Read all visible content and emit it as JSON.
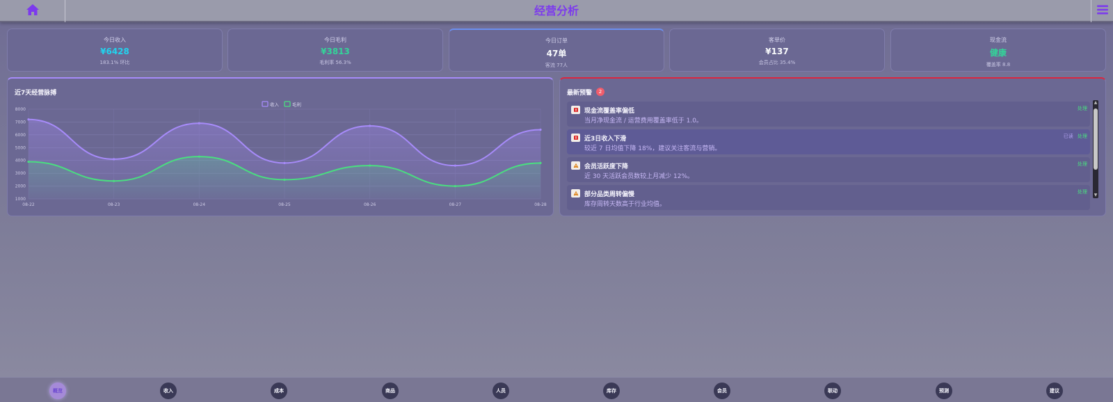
{
  "header": {
    "title": "经营分析",
    "home_icon": "home-icon",
    "menu_icon": "hamburger-menu-icon",
    "accent_color": "#7c3aed"
  },
  "kpis": [
    {
      "label": "今日收入",
      "value": "¥6428",
      "sub": "183.1% 环比",
      "color": "#22d3ee"
    },
    {
      "label": "今日毛利",
      "value": "¥3813",
      "sub": "毛利率 56.3%",
      "color": "#34d399"
    },
    {
      "label": "今日订单",
      "value": "47单",
      "sub": "客流 77人",
      "color": "#f8fafc"
    },
    {
      "label": "客单价",
      "value": "¥137",
      "sub": "会员占比 35.4%",
      "color": "#f8fafc"
    },
    {
      "label": "现金流",
      "value": "健康",
      "sub": "覆盖率 8.8",
      "color": "#34d399"
    }
  ],
  "trend_panel": {
    "title": "近7天经营脉搏"
  },
  "chart_data": {
    "type": "line",
    "title": "近7天经营脉搏",
    "categories": [
      "08-22",
      "08-23",
      "08-24",
      "08-25",
      "08-26",
      "08-27",
      "08-28"
    ],
    "series": [
      {
        "name": "收入",
        "color": "#a78bfa",
        "values": [
          7200,
          4100,
          6900,
          3800,
          6700,
          3600,
          6400
        ]
      },
      {
        "name": "毛利",
        "color": "#4ade80",
        "values": [
          3900,
          2400,
          4300,
          2500,
          3600,
          2000,
          3800
        ]
      }
    ],
    "ylim": [
      1000,
      8000
    ],
    "yticks": [
      "1000",
      "2000",
      "3000",
      "4000",
      "5000",
      "6000",
      "7000",
      "8000"
    ],
    "grid": true,
    "legend_position": "top-center",
    "smooth": true
  },
  "alerts_panel": {
    "title": "最新预警",
    "badge_count": "2",
    "items": [
      {
        "icon": "red-alert-icon",
        "icon_color": "#dc2626",
        "title": "现金流覆盖率偏低",
        "desc": "当月净现金流 / 运营费用覆盖率低于 1.0。",
        "read_label": "",
        "action_label": "处理"
      },
      {
        "icon": "red-alert-icon",
        "icon_color": "#dc2626",
        "title": "近3日收入下滑",
        "desc": "较近 7 日均值下降 18%，建议关注客流与营销。",
        "read_label": "已读",
        "action_label": "处理"
      },
      {
        "icon": "warning-icon",
        "icon_color": "#d97706",
        "title": "会员活跃度下降",
        "desc": "近 30 天活跃会员数较上月减少 12%。",
        "read_label": "",
        "action_label": "处理"
      },
      {
        "icon": "warning-icon",
        "icon_color": "#d97706",
        "title": "部分品类周转偏慢",
        "desc": "库存周转天数高于行业均值。",
        "read_label": "",
        "action_label": "处理"
      }
    ]
  },
  "bottom_nav": {
    "items": [
      "概览",
      "收入",
      "成本",
      "商品",
      "人员",
      "库存",
      "会员",
      "联动",
      "预测",
      "建议"
    ],
    "active_index": 0
  }
}
